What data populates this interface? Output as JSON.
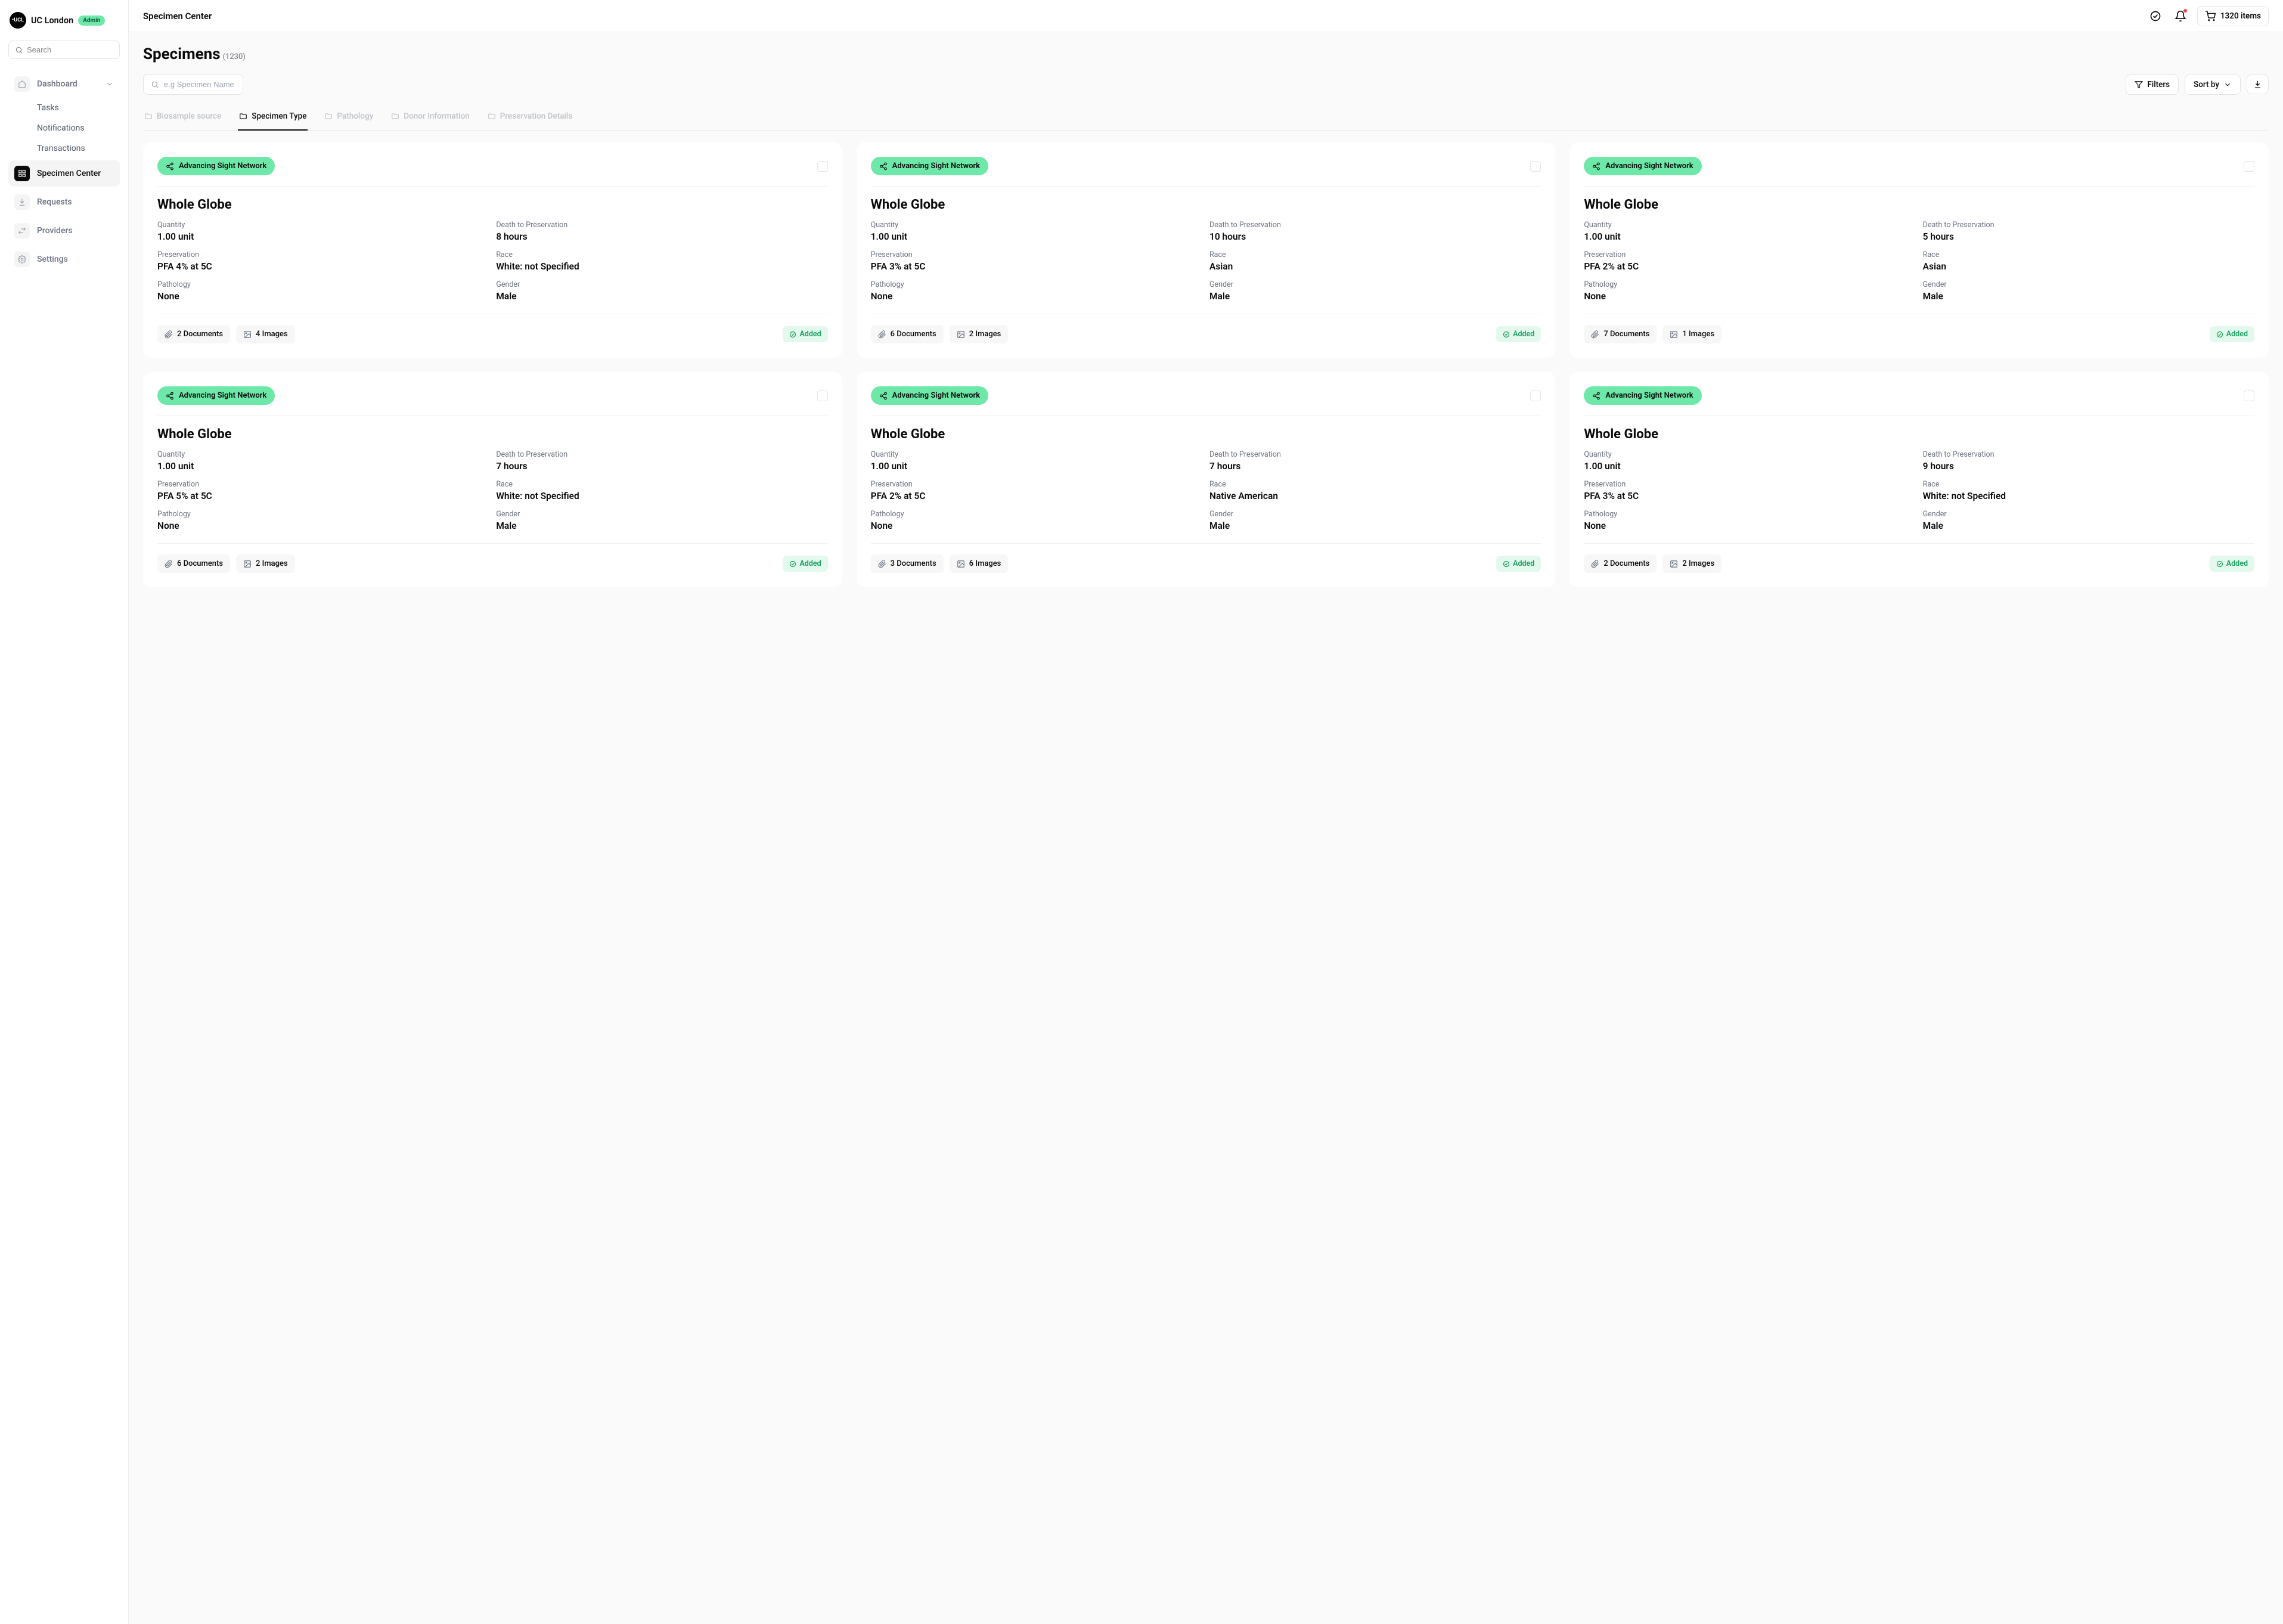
{
  "brand": {
    "logo_text": "•UCL",
    "name": "UC London",
    "badge": "Admin"
  },
  "sidebar": {
    "search_placeholder": "Search",
    "items": [
      {
        "label": "Dashboard",
        "expandable": true
      },
      {
        "label": "Specimen Center"
      },
      {
        "label": "Requests"
      },
      {
        "label": "Providers"
      },
      {
        "label": "Settings"
      }
    ],
    "dashboard_sub": [
      "Tasks",
      "Notifications",
      "Transactions"
    ]
  },
  "topbar": {
    "title": "Specimen Center",
    "cart_count": "1320 items"
  },
  "page": {
    "title": "Specimens",
    "count": "(1230)",
    "search_placeholder": "e.g Specimen Name"
  },
  "toolbar": {
    "filters": "Filters",
    "sort_by": "Sort by"
  },
  "tabs": [
    "Biosample source",
    "Specimen Type",
    "Pathology",
    "Donor Information",
    "Preservation Details"
  ],
  "tabs_active_index": 1,
  "labels": {
    "quantity": "Quantity",
    "dtp": "Death to Preservation",
    "preservation": "Preservation",
    "race": "Race",
    "pathology": "Pathology",
    "gender": "Gender",
    "added": "Added"
  },
  "cards": [
    {
      "network": "Advancing Sight Network",
      "title": "Whole Globe",
      "quantity": "1.00 unit",
      "dtp": "8 hours",
      "preservation": "PFA 4% at 5C",
      "race": "White: not Specified",
      "pathology": "None",
      "gender": "Male",
      "docs": "2 Documents",
      "images": "4 Images",
      "added": true
    },
    {
      "network": "Advancing Sight Network",
      "title": "Whole Globe",
      "quantity": "1.00 unit",
      "dtp": "10 hours",
      "preservation": "PFA 3% at 5C",
      "race": "Asian",
      "pathology": "None",
      "gender": "Male",
      "docs": "6 Documents",
      "images": "2 Images",
      "added": true
    },
    {
      "network": "Advancing Sight Network",
      "title": "Whole Globe",
      "quantity": "1.00 unit",
      "dtp": "5 hours",
      "preservation": "PFA 2% at 5C",
      "race": "Asian",
      "pathology": "None",
      "gender": "Male",
      "docs": "7 Documents",
      "images": "1 Images",
      "added": true
    },
    {
      "network": "Advancing Sight Network",
      "title": "Whole Globe",
      "quantity": "1.00 unit",
      "dtp": "7 hours",
      "preservation": "PFA 5% at 5C",
      "race": "White: not Specified",
      "pathology": "None",
      "gender": "Male",
      "docs": "6 Documents",
      "images": "2 Images",
      "added": true
    },
    {
      "network": "Advancing Sight Network",
      "title": "Whole Globe",
      "quantity": "1.00 unit",
      "dtp": "7 hours",
      "preservation": "PFA 2% at 5C",
      "race": "Native American",
      "pathology": "None",
      "gender": "Male",
      "docs": "3 Documents",
      "images": "6 Images",
      "added": true
    },
    {
      "network": "Advancing Sight Network",
      "title": "Whole Globe",
      "quantity": "1.00 unit",
      "dtp": "9 hours",
      "preservation": "PFA 3% at 5C",
      "race": "White: not Specified",
      "pathology": "None",
      "gender": "Male",
      "docs": "2 Documents",
      "images": "2 Images",
      "added": true
    }
  ]
}
